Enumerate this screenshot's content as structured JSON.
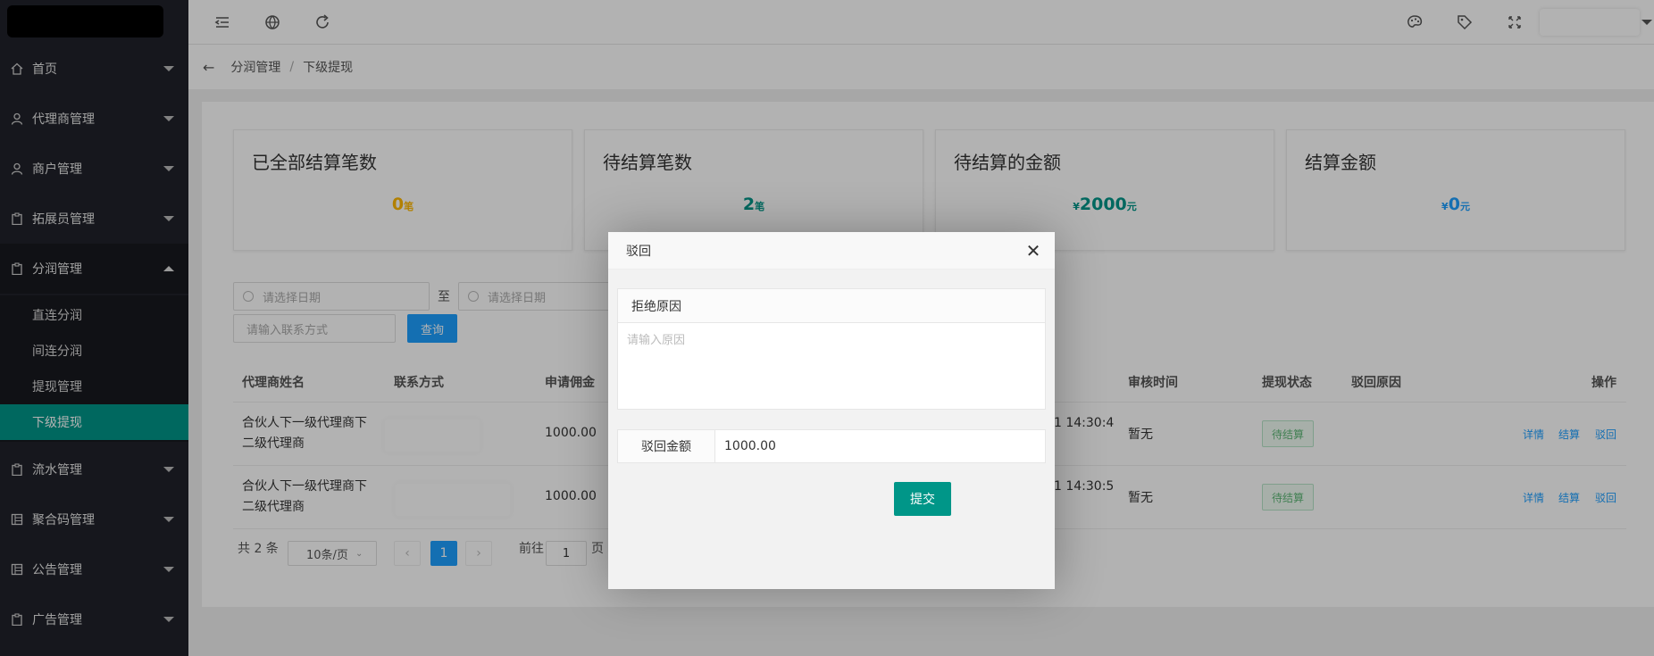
{
  "sidebar": {
    "items": [
      {
        "label": "首页",
        "icon": "home-icon"
      },
      {
        "label": "代理商管理",
        "icon": "user-icon"
      },
      {
        "label": "商户管理",
        "icon": "user-icon"
      },
      {
        "label": "拓展员管理",
        "icon": "clipboard-icon"
      },
      {
        "label": "分润管理",
        "icon": "clipboard-icon"
      },
      {
        "label": "流水管理",
        "icon": "clipboard-icon"
      },
      {
        "label": "聚合码管理",
        "icon": "grid-icon"
      },
      {
        "label": "公告管理",
        "icon": "grid-icon"
      },
      {
        "label": "广告管理",
        "icon": "clipboard-icon"
      }
    ],
    "subitems": [
      "直连分润",
      "间连分润",
      "提现管理",
      "下级提现"
    ]
  },
  "breadcrumb": {
    "parent": "分润管理",
    "separator": "/",
    "current": "下级提现"
  },
  "stats": [
    {
      "title": "已全部结算笔数",
      "prefix": "",
      "value": "0",
      "unit": "笔",
      "color": "#ffb800"
    },
    {
      "title": "待结算笔数",
      "prefix": "",
      "value": "2",
      "unit": "笔",
      "color": "#009688"
    },
    {
      "title": "待结算的金额",
      "prefix": "¥",
      "value": "2000",
      "unit": "元",
      "color": "#009688"
    },
    {
      "title": "结算金额",
      "prefix": "¥",
      "value": "0",
      "unit": "元",
      "color": "#1e9fff"
    }
  ],
  "filters": {
    "date_placeholder": "请选择日期",
    "to_label": "至",
    "contact_placeholder": "请输入联系方式",
    "query_label": "查询"
  },
  "table": {
    "headers": [
      "代理商姓名",
      "联系方式",
      "申请佣金",
      "审核时间",
      "提现状态",
      "驳回原因",
      "操作"
    ],
    "rows": [
      {
        "name": "合伙人下一级代理商下二级代理商",
        "amount": "1000.00",
        "apply_time_fragment": "1 14:30:4",
        "review_time": "暂无",
        "status": "待结算"
      },
      {
        "name": "合伙人下一级代理商下二级代理商",
        "amount": "1000.00",
        "apply_time_fragment": "1 14:30:5",
        "review_time": "暂无",
        "status": "待结算"
      }
    ],
    "ops": [
      "详情",
      "结算",
      "驳回"
    ]
  },
  "pager": {
    "total": "共 2 条",
    "page_size": "10条/页",
    "prev": "‹",
    "current": "1",
    "next": "›",
    "goto_label": "前往",
    "goto_value": "1",
    "page_suffix": "页"
  },
  "modal": {
    "title": "驳回",
    "close": "✕",
    "reason_label": "拒绝原因",
    "reason_placeholder": "请输入原因",
    "amount_label": "驳回金额",
    "amount_value": "1000.00",
    "submit_label": "提交"
  }
}
